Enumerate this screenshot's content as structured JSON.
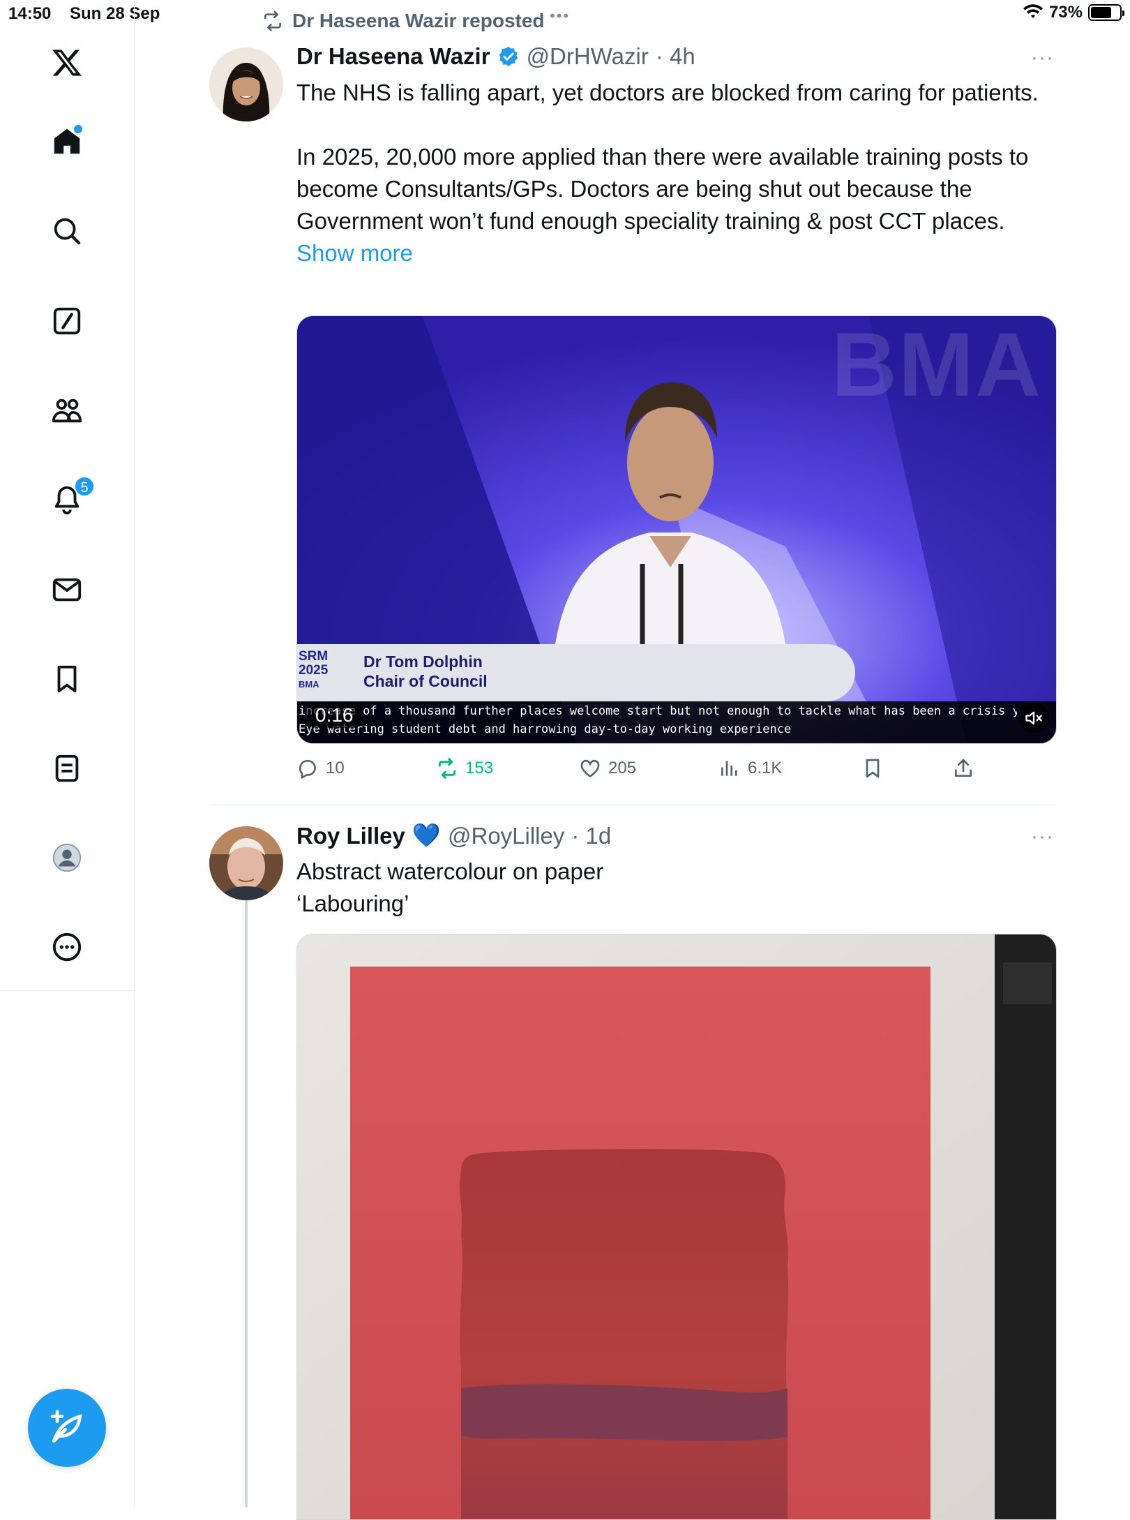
{
  "status_bar": {
    "time": "14:50",
    "date": "Sun 28 Sep",
    "battery": "73%"
  },
  "sidebar": {
    "items": [
      "X",
      "Home",
      "Search",
      "Grok",
      "Communities",
      "Notifications",
      "Messages",
      "Bookmarks",
      "Lists",
      "Profile",
      "More"
    ],
    "notifications_badge": "5",
    "compose_label": "Post"
  },
  "repost_banner": "Dr Haseena Wazir reposted",
  "tweet1": {
    "name": "Dr Haseena Wazir",
    "handle": "@DrHWazir",
    "time": "· 4h",
    "more": "···",
    "text": "The NHS is falling apart, yet doctors are blocked from caring for patients.\n\nIn 2025, 20,000 more applied than there were available training posts to become Consultants/GPs. Doctors are being shut out because the Government won’t fund enough speciality training & post CCT places. ",
    "show_more": "Show more",
    "video": {
      "watermark": "BMA",
      "event_tag_line1": "SRM",
      "event_tag_line2": "2025",
      "event_tag_line3": "BMA",
      "speaker_name": "Dr Tom Dolphin",
      "speaker_title": "Chair of Council",
      "duration": "0:16",
      "caption_line1": "increase of a thousand further places welcome start but not enough to tackle what has been a crisis years in the making.",
      "caption_line2": "Eye watering student debt and harrowing day-to-day working experience"
    },
    "stats": {
      "replies": "10",
      "reposts": "153",
      "likes": "205",
      "views": "6.1K"
    }
  },
  "tweet2": {
    "name": "Roy Lilley",
    "heart": "💙",
    "handle": "@RoyLilley",
    "time": "· 1d",
    "more": "···",
    "text": "Abstract watercolour on paper\n‘Labouring’"
  },
  "colors": {
    "accent": "#1d9bf0",
    "repost_green": "#00ba7c",
    "text": "#0f1419",
    "muted": "#536471"
  }
}
